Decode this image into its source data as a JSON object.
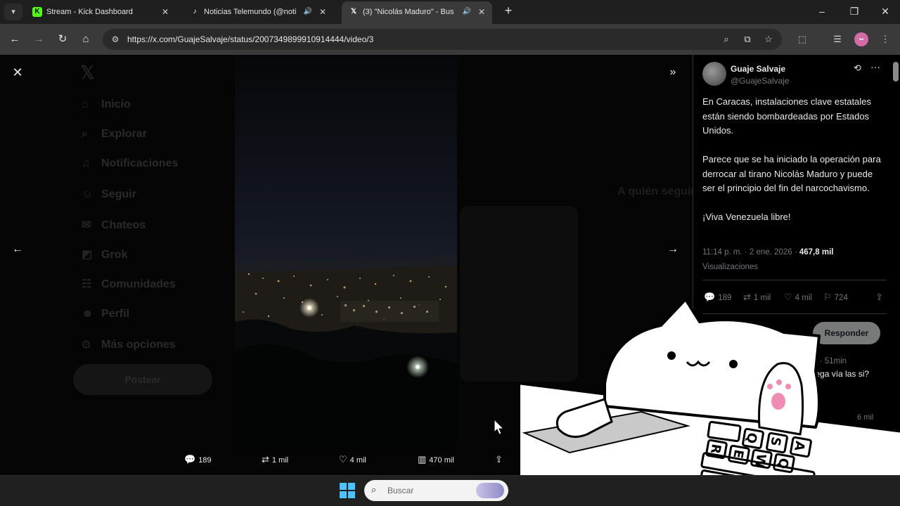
{
  "browser": {
    "tabs": [
      {
        "title": "Stream - Kick Dashboard",
        "favicon": "kick-icon",
        "active": false,
        "audio": false
      },
      {
        "title": "Noticias Telemundo (@noti",
        "favicon": "tiktok-icon",
        "active": false,
        "audio": true
      },
      {
        "title": "(3) \"Nicolás Maduro\" - Bus",
        "favicon": "x-icon",
        "active": true,
        "audio": true
      }
    ],
    "url": "https://x.com/GuajeSalvaje/status/2007349899910914444/video/3"
  },
  "background_page": {
    "nav_items": [
      "Inicio",
      "Explorar",
      "Notificaciones",
      "Seguir",
      "Chateos",
      "Grok",
      "Comunidades",
      "Perfil",
      "Más opciones"
    ],
    "post_button": "Postear",
    "who_to_follow": "A quién seguir"
  },
  "viewer": {
    "stats": {
      "replies": "189",
      "reposts": "1 mil",
      "likes": "4 mil",
      "views": "470 mil"
    }
  },
  "tweet": {
    "author_name": "Guaje Salvaje",
    "author_handle": "@GuajeSalvaje",
    "paragraphs": [
      "En Caracas, instalaciones clave estatales están siendo bombardeadas por Estados Unidos.",
      "Parece que se ha iniciado la operación para derrocar al tirano Nicolás Maduro y puede ser el principio del fin del narcochavismo.",
      "¡Viva Venezuela libre!"
    ],
    "timestamp": "11:14 p. m. · 2 ene. 2026 · ",
    "view_count": "467,8 mil",
    "view_label": "Visualizaciones",
    "actions": {
      "replies": "189",
      "reposts": "1 mil",
      "likes": "4 mil",
      "bookmarks": "724"
    },
    "reply_button": "Responder",
    "reply_preview": {
      "time": "ju... · 51min",
      "text": "e llega vía las si?",
      "views": "6 mil"
    }
  },
  "taskbar": {
    "search_label": "Buscar"
  },
  "colors": {
    "x_text": "#e7e9ea",
    "x_muted": "#71767b",
    "chrome_bg": "#1f1f1f",
    "kick_green": "#53fc18"
  }
}
